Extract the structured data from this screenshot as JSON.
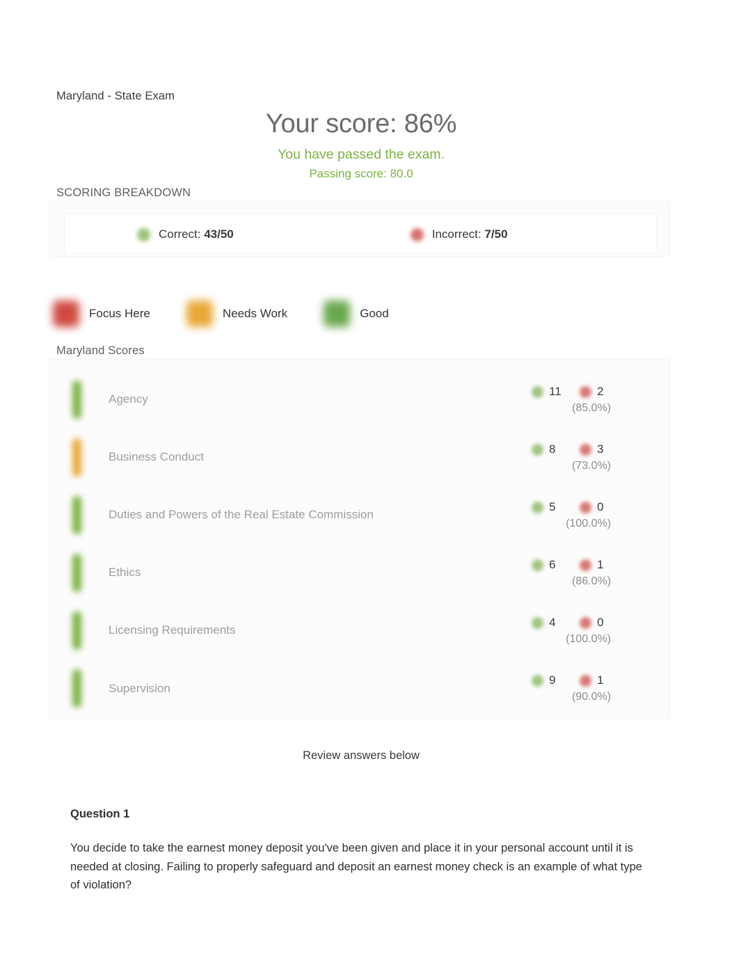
{
  "exam": {
    "title": "Maryland - State Exam",
    "score_headline": "Your score: 86%",
    "pass_message": "You have passed the exam.",
    "passing_score": "Passing score: 80.0"
  },
  "breakdown": {
    "label": "SCORING BREAKDOWN",
    "correct_prefix": "Correct: ",
    "correct_value": "43/50",
    "incorrect_prefix": "Incorrect: ",
    "incorrect_value": "7/50"
  },
  "legend": {
    "items": [
      {
        "label": "Focus Here",
        "color": "#d04a42",
        "icon": "square-swatch"
      },
      {
        "label": "Needs Work",
        "color": "#e8a837",
        "icon": "square-swatch"
      },
      {
        "label": "Good",
        "color": "#6aa84f",
        "icon": "square-swatch"
      }
    ]
  },
  "scores": {
    "label": "Maryland Scores",
    "rows": [
      {
        "topic": "Agency",
        "correct": "11",
        "incorrect": "2",
        "percent": "(85.0%)",
        "status_color": "#7cb342",
        "status": "Good"
      },
      {
        "topic": "Business Conduct",
        "correct": "8",
        "incorrect": "3",
        "percent": "(73.0%)",
        "status_color": "#e8a837",
        "status": "Needs Work"
      },
      {
        "topic": "Duties and Powers of the Real Estate Commission",
        "correct": "5",
        "incorrect": "0",
        "percent": "(100.0%)",
        "status_color": "#7cb342",
        "status": "Good"
      },
      {
        "topic": "Ethics",
        "correct": "6",
        "incorrect": "1",
        "percent": "(86.0%)",
        "status_color": "#7cb342",
        "status": "Good"
      },
      {
        "topic": "Licensing Requirements",
        "correct": "4",
        "incorrect": "0",
        "percent": "(100.0%)",
        "status_color": "#7cb342",
        "status": "Good"
      },
      {
        "topic": "Supervision",
        "correct": "9",
        "incorrect": "1",
        "percent": "(90.0%)",
        "status_color": "#7cb342",
        "status": "Good"
      }
    ]
  },
  "review": {
    "note": "Review answers below",
    "question_number": "Question 1",
    "question_text": "You decide to take the earnest money deposit you've been given and place it in your personal account until it is needed at closing. Failing to properly safeguard and deposit an earnest money check is an example of what type of violation?"
  },
  "chart_data": {
    "type": "bar",
    "title": "Maryland Scores",
    "categories": [
      "Agency",
      "Business Conduct",
      "Duties and Powers of the Real Estate Commission",
      "Ethics",
      "Licensing Requirements",
      "Supervision"
    ],
    "series": [
      {
        "name": "Correct",
        "values": [
          11,
          8,
          5,
          6,
          4,
          9
        ]
      },
      {
        "name": "Incorrect",
        "values": [
          2,
          3,
          0,
          1,
          0,
          1
        ]
      }
    ],
    "percent_values": [
      85.0,
      73.0,
      100.0,
      86.0,
      100.0,
      90.0
    ],
    "xlabel": "",
    "ylabel": "",
    "legend_position": "top"
  }
}
